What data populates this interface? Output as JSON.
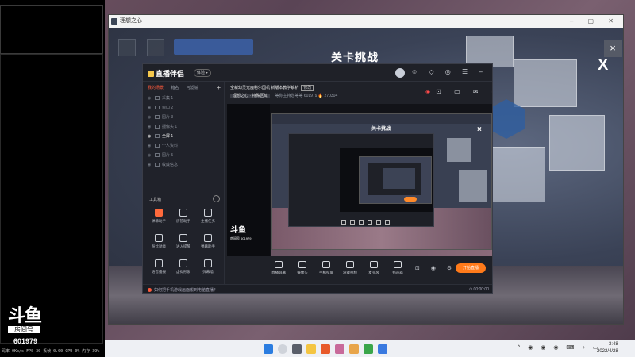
{
  "overlay": {
    "logo_text": "斗鱼",
    "logo_sub": "房间号",
    "room_number": "601979",
    "stats": "码率 0Kb/s FPS 30 丢帧 0.00  CPU 0% 内存 39%"
  },
  "game": {
    "window_title": "理想之心",
    "dialog_title": "关卡挑战",
    "close_glyph": "X",
    "top_close_glyph": "×"
  },
  "app": {
    "logo": "直播伴侣",
    "version": "体验 ▸",
    "sidebar_tabs": [
      "我的场景",
      "箱名",
      "可滤镜"
    ],
    "scenes": [
      {
        "label": "采集 1",
        "active": false
      },
      {
        "label": "窗口 2",
        "active": false
      },
      {
        "label": "图片 3",
        "active": false
      },
      {
        "label": "摄像头 1",
        "active": false
      },
      {
        "label": "全屏 1",
        "active": true
      },
      {
        "label": "个人资料",
        "active": false
      },
      {
        "label": "图片 5",
        "active": false
      },
      {
        "label": "收藏信息",
        "active": false
      }
    ],
    "toolbox_title": "工具箱",
    "tools": [
      {
        "label": "弹幕助手",
        "hot": true
      },
      {
        "label": "房管助手",
        "hot": false
      },
      {
        "label": "主播任务",
        "hot": false
      },
      {
        "label": "粉丝勋章",
        "hot": false
      },
      {
        "label": "进入提醒",
        "hot": false
      },
      {
        "label": "弹幕助手",
        "hot": false
      },
      {
        "label": "语音播报",
        "hot": false
      },
      {
        "label": "虚拟形象",
        "hot": false
      },
      {
        "label": "弹幕墙",
        "hot": false
      }
    ],
    "live_title": "全新幻灵光魔秘尔国机 新版本教学解析",
    "live_tag": "修改",
    "live_category": "理想之心 · 特殊区域",
    "live_meta": "等你主持您等等  601979",
    "live_hot": "🔥 270304",
    "preview_logo": "斗鱼",
    "preview_logo_sub": "房间号 601979",
    "nested_title": "关卡挑战",
    "nested_close": "×",
    "controls": [
      "直播屏幕",
      "摄像头",
      "手机投屏",
      "游戏视频",
      "麦克风",
      "扬声器"
    ],
    "start_live": "开始直播",
    "footer_tip": "如何把手机游戏画面搬到电脑直播？",
    "footer_time": "⊙ 00:00:00"
  },
  "taskbar": {
    "time": "3:48",
    "date": "2022/4/28"
  },
  "colors": {
    "accent": "#ff7a1a",
    "brand_red": "#ff5a3c"
  }
}
